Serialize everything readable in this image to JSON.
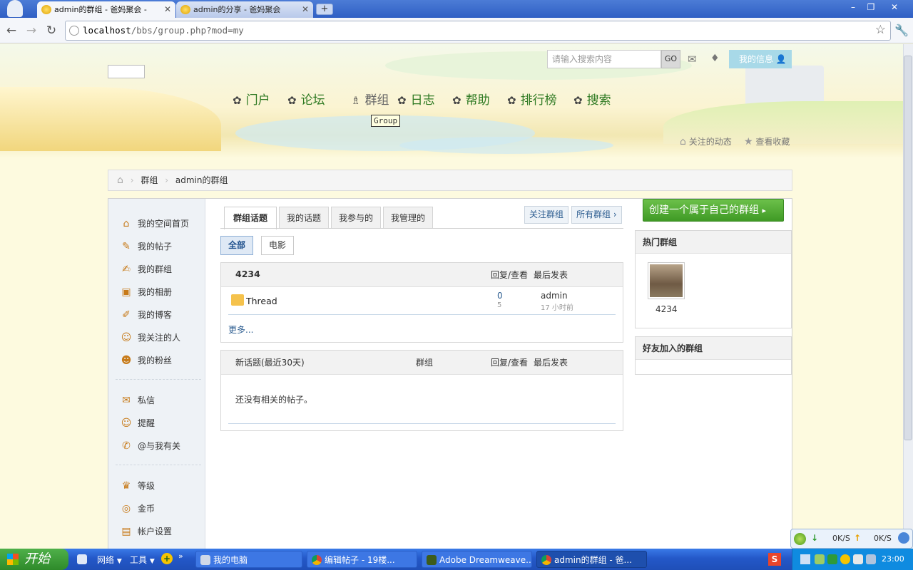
{
  "browser": {
    "tabs": [
      {
        "label": "admin的群组 - 爸妈聚会 -",
        "active": true
      },
      {
        "label": "admin的分享 - 爸妈聚会",
        "active": false
      }
    ],
    "url_host": "localhost",
    "url_path": "/bbs/group.php?mod=my"
  },
  "header": {
    "search_placeholder": "请输入搜索内容",
    "search_button": "GO",
    "my_info": "我的信息",
    "nav": [
      "门户",
      "论坛",
      "群组",
      "日志",
      "帮助",
      "排行榜",
      "搜索"
    ],
    "tooltip": "Group",
    "follow_link": "关注的动态",
    "favorites_link": "查看收藏"
  },
  "breadcrumb": {
    "item1": "群组",
    "item2": "admin的群组"
  },
  "sidebar": {
    "items": [
      "我的空间首页",
      "我的帖子",
      "我的群组",
      "我的相册",
      "我的博客",
      "我关注的人",
      "我的粉丝"
    ],
    "items2": [
      "私信",
      "提醒",
      "@与我有关"
    ],
    "items3": [
      "等级",
      "金币",
      "帐户设置"
    ]
  },
  "main": {
    "tabs": [
      "群组话题",
      "我的话题",
      "我参与的",
      "我管理的"
    ],
    "right_buttons": [
      "关注群组",
      "所有群组 ›"
    ],
    "filters": [
      "全部",
      "电影"
    ],
    "table1": {
      "title": "4234",
      "col_reply": "回复/查看",
      "col_last": "最后发表",
      "row": {
        "title": "Thread",
        "replies": "0",
        "views": "5",
        "author": "admin",
        "time": "17 小时前"
      },
      "more": "更多..."
    },
    "table2": {
      "title": "新话题(最近30天)",
      "col_group": "群组",
      "col_reply": "回复/查看",
      "col_last": "最后发表",
      "empty": "还没有相关的帖子。"
    }
  },
  "right": {
    "create_button": "创建一个属于自己的群组",
    "hot_title": "热门群组",
    "hot_group_name": "4234",
    "friends_title": "好友加入的群组"
  },
  "taskbar": {
    "start": "开始",
    "quick": [
      "网络",
      "工具"
    ],
    "tasks": [
      "我的电脑",
      "编辑帖子 - 19楼...",
      "Adobe Dreamweave...",
      "admin的群组 - 爸..."
    ],
    "speed_down": "0K/S",
    "speed_up": "0K/S",
    "clock": "23:00"
  },
  "colors": {
    "nav_green": "#2f7a23",
    "link_blue": "#2e5e91",
    "create_green": "#4caa2f",
    "taskbar_blue": "#2458c8"
  }
}
